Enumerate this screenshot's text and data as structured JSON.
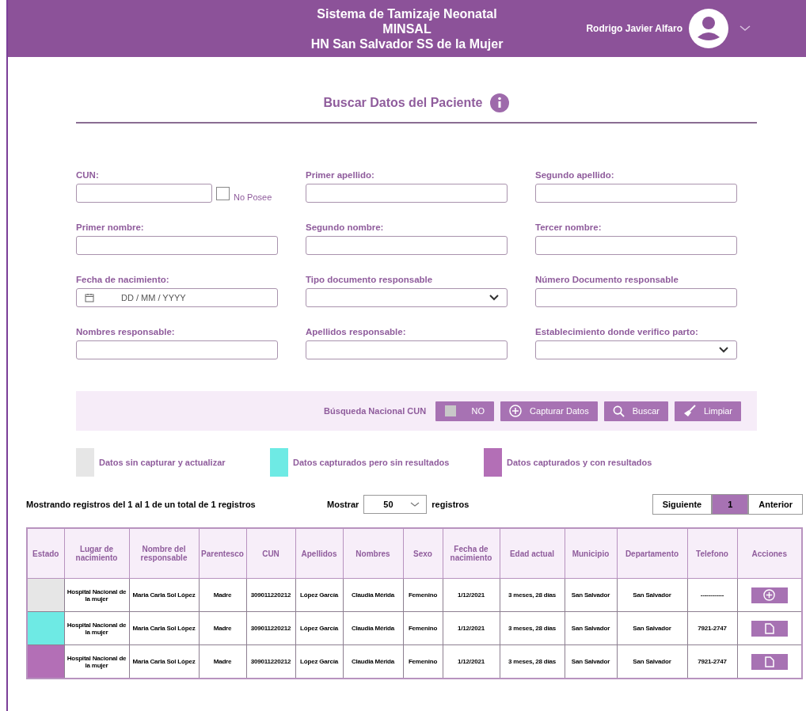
{
  "header": {
    "title_lines": [
      "Sistema de Tamizaje Neonatal",
      "MINSAL",
      "HN San Salvador SS de la Mujer"
    ],
    "user_name": "Rodrigo Javier Alfaro"
  },
  "page_title": "Buscar Datos del Paciente",
  "fields": [
    {
      "label": "CUN:",
      "kind": "text",
      "checkbox": {
        "label": "No Posee",
        "checked": false
      }
    },
    {
      "label": "Primer apellido:",
      "kind": "text"
    },
    {
      "label": "Segundo apellido:",
      "kind": "text"
    },
    {
      "label": "Primer nombre:",
      "kind": "text"
    },
    {
      "label": "Segundo nombre:",
      "kind": "text"
    },
    {
      "label": "Tercer nombre:",
      "kind": "text"
    },
    {
      "label": "Fecha de nacimiento:",
      "kind": "date",
      "placeholder": "DD / MM / YYYY"
    },
    {
      "label": "Tipo documento responsable",
      "kind": "select"
    },
    {
      "label": "Número Documento responsable",
      "kind": "text"
    },
    {
      "label": "Nombres responsable:",
      "kind": "text"
    },
    {
      "label": "Apellidos responsable:",
      "kind": "text"
    },
    {
      "label": "Establecimiento donde verifico parto:",
      "kind": "select"
    }
  ],
  "search_bar": {
    "national_label": "Búsqueda Nacional CUN",
    "toggle": {
      "label": "NO",
      "on": false
    },
    "buttons": [
      {
        "label": "Capturar Datos",
        "kind": "capture"
      },
      {
        "label": "Buscar",
        "kind": "search"
      },
      {
        "label": "Limpiar",
        "kind": "clear"
      }
    ]
  },
  "legend": [
    {
      "label": "Datos sin  capturar y actualizar",
      "color": "#e6e6e6"
    },
    {
      "label": "Datos capturados pero sin resultados",
      "color": "#6eeae4"
    },
    {
      "label": "Datos capturados y con resultados",
      "color": "#b36fb6"
    }
  ],
  "summary": "Mostrando registros del 1 al 1 de un total de 1 registros",
  "page_size": {
    "label": "Mostrar",
    "value": "50",
    "suffix": "registros"
  },
  "pagination": [
    {
      "label": "Siguiente",
      "selected": false
    },
    {
      "label": "1",
      "selected": true
    },
    {
      "label": "Anterior",
      "selected": false
    }
  ],
  "table": {
    "columns": [
      "Estado",
      "Lugar de nacimiento",
      "Nombre del responsable",
      "Parentesco",
      "CUN",
      "Apellidos",
      "Nombres",
      "Sexo",
      "Fecha de nacimiento",
      "Edad actual",
      "Municipio",
      "Departamento",
      "Telefono",
      "Acciones"
    ],
    "rows": [
      {
        "color": "#e6e6e6",
        "cells": [
          "",
          "Hospital Nacional de la mujer",
          "Maria Carla Sol López",
          "Madre",
          "309011220212",
          "López García",
          "Claudia Mérida",
          "Femenino",
          "1/12/2021",
          "3 meses, 28 días",
          "San Salvador",
          "San Salvador",
          "------------"
        ],
        "kind": "add"
      },
      {
        "color": "#6eeae4",
        "cells": [
          "",
          "Hospital Nacional de la mujer",
          "Maria Carla Sol López",
          "Madre",
          "309011220212",
          "López García",
          "Claudia Mérida",
          "Femenino",
          "1/12/2021",
          "3 meses, 28 días",
          "San Salvador",
          "San Salvador",
          "7921-2747"
        ],
        "kind": "document"
      },
      {
        "color": "#b36fb6",
        "cells": [
          "",
          "Hospital Nacional de la mujer",
          "Maria Carla Sol López",
          "Madre",
          "309011220212",
          "López García",
          "Claudia Mérida",
          "Femenino",
          "1/12/2021",
          "3 meses, 28 días",
          "San Salvador",
          "San Salvador",
          "7921-2747"
        ],
        "kind": "document"
      }
    ]
  }
}
